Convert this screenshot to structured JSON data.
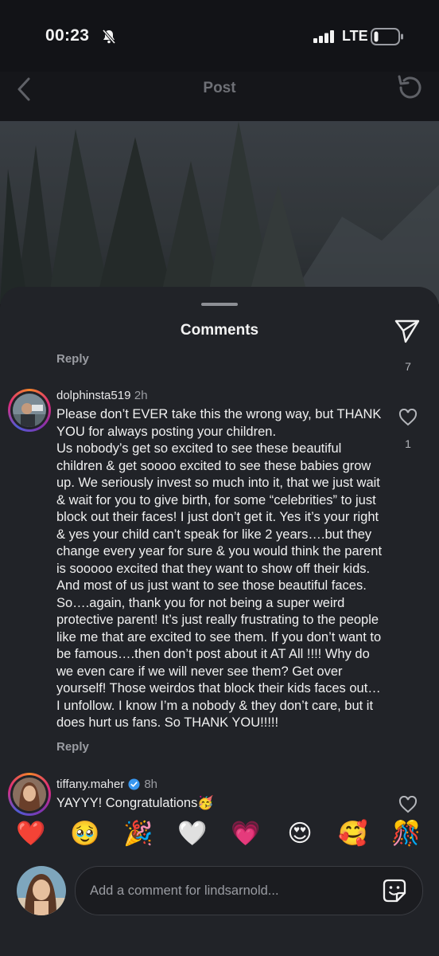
{
  "status": {
    "time": "00:23",
    "network": "LTE"
  },
  "header": {
    "title": "Post"
  },
  "sheet": {
    "title": "Comments"
  },
  "prev_comment": {
    "reply_label": "Reply",
    "like_count": "7"
  },
  "comment1": {
    "username": "dolphinsta519",
    "time_ago": "2h",
    "paragraph1": "Please don’t EVER take this the wrong way, but THANK YOU for always posting your children.",
    "paragraph2": "Us nobody’s get so excited to see these beautiful children & get soooo excited to see these babies grow up. We seriously invest so much into it, that we just wait & wait for you to give birth, for some “celebrities” to just block out their faces! I just don’t get it. Yes it’s your right & yes your child can’t speak for like 2 years….but they change every year for sure & you would think the parent is sooooo excited that they want to show off their kids. And most of us just want to see those beautiful faces. So….again, thank you for not being a super weird protective parent! It’s just really frustrating to the people like me that are excited to see them. If you don’t want to be famous….then don’t post about it AT All !!!! Why do we even care if we will never see them? Get over yourself! Those weirdos that block their kids faces out…I unfollow. I know I’m a nobody & they don’t care, but it does hurt us fans. So THANK YOU!!!!!",
    "like_count": "1",
    "reply_label": "Reply"
  },
  "comment2": {
    "username": "tiffany.maher",
    "time_ago": "8h",
    "text": "YAYYY! Congratulations🥳"
  },
  "reactions": [
    "❤️",
    "🥹",
    "🎉",
    "🤍",
    "💗",
    "😍",
    "🥰",
    "🎊"
  ],
  "composer": {
    "placeholder": "Add a comment for lindsarnold..."
  },
  "icons": {
    "status": [
      "bell-slash-icon",
      "signal-icon",
      "battery-icon"
    ],
    "header": [
      "back-chevron-icon",
      "refresh-icon"
    ],
    "sheet": [
      "send-icon",
      "heart-icon",
      "verified-badge-icon",
      "sticker-icon"
    ]
  }
}
